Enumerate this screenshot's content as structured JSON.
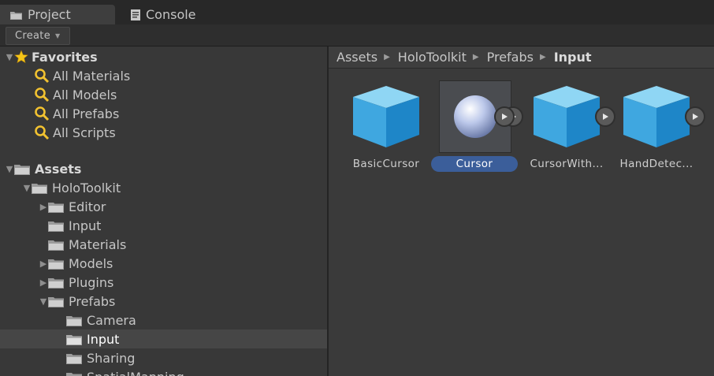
{
  "tabs": [
    {
      "label": "Project",
      "icon": "folder-icon",
      "active": true
    },
    {
      "label": "Console",
      "icon": "console-icon",
      "active": false
    }
  ],
  "toolbar": {
    "create_label": "Create"
  },
  "favorites": {
    "label": "Favorites",
    "items": [
      "All Materials",
      "All Models",
      "All Prefabs",
      "All Scripts"
    ]
  },
  "assets_tree": {
    "root": "Assets",
    "holotoolkit": "HoloToolkit",
    "children": [
      "Editor",
      "Input",
      "Materials",
      "Models",
      "Plugins",
      "Prefabs"
    ],
    "prefabs_children": [
      "Camera",
      "Input",
      "Sharing",
      "SpatialMapping"
    ],
    "selected": "Input"
  },
  "breadcrumb": [
    "Assets",
    "HoloToolkit",
    "Prefabs",
    "Input"
  ],
  "assets": [
    {
      "name": "BasicCursor",
      "icon": "prefab-cube-icon",
      "selected": false
    },
    {
      "name": "Cursor",
      "icon": "sphere-icon",
      "selected": true
    },
    {
      "name": "CursorWith...",
      "icon": "prefab-cube-icon",
      "selected": false
    },
    {
      "name": "HandDetec...",
      "icon": "prefab-cube-icon",
      "selected": false
    }
  ],
  "colors": {
    "selection": "#3b5e9a",
    "panel": "#383838",
    "favorites_star": "#f5c518",
    "search_icon": "#f2c230"
  }
}
